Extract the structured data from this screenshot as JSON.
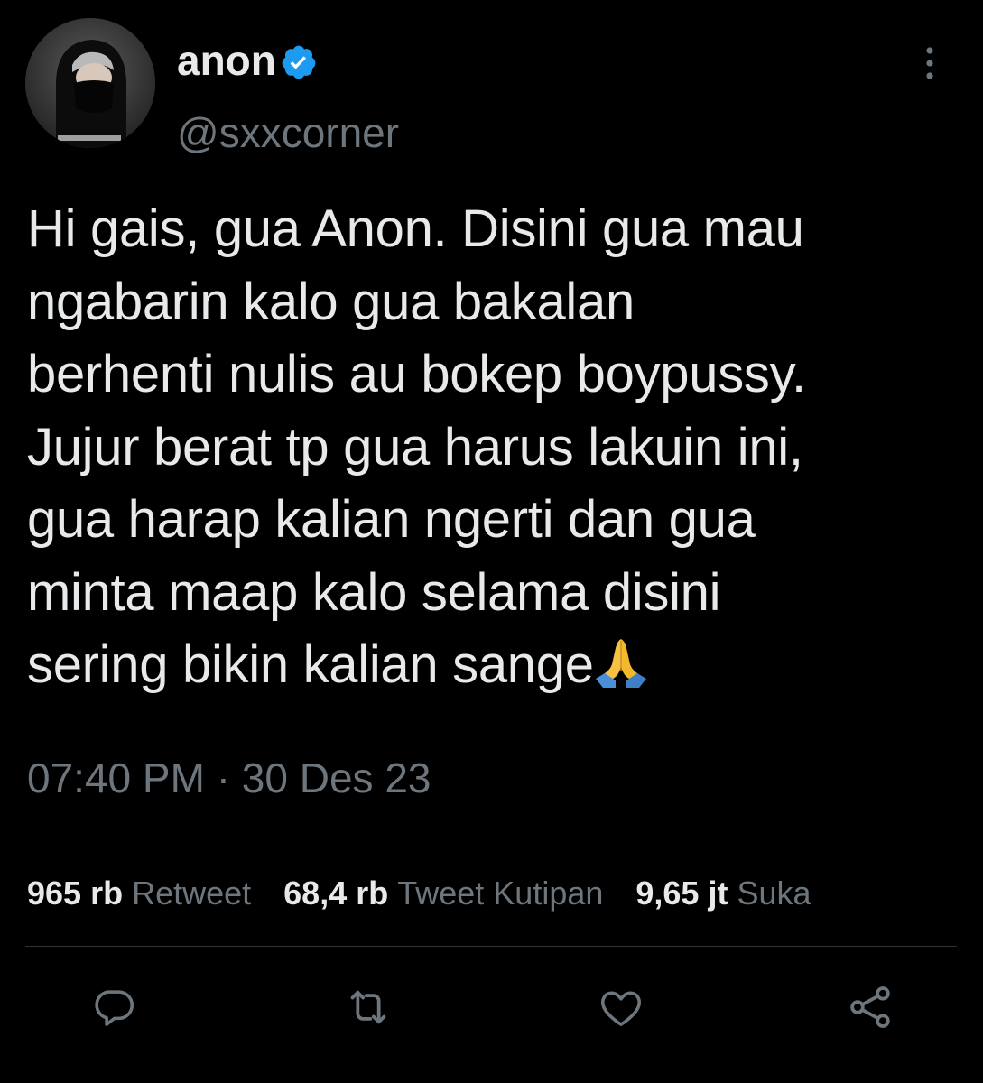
{
  "tweet": {
    "display_name": "anon",
    "handle": "@sxxcorner",
    "lines": [
      "Hi gais, gua Anon. Disini gua mau",
      "ngabarin kalo gua bakalan",
      "berhenti nulis au bokep boypussy.",
      "Jujur berat tp gua harus lakuin ini,",
      "gua harap kalian ngerti dan gua",
      "minta maap kalo selama disini",
      "sering bikin kalian sange"
    ],
    "emoji": "🙏",
    "time": "07:40 PM",
    "separator": "·",
    "date": "30 Des 23"
  },
  "stats": {
    "retweets_count": "965 rb",
    "retweets_label": "Retweet",
    "quotes_count": "68,4 rb",
    "quotes_label": "Tweet Kutipan",
    "likes_count": "9,65 jt",
    "likes_label": "Suka"
  },
  "icons": {
    "verified": "verified-badge-icon",
    "more": "more-vertical-icon",
    "reply": "reply-icon",
    "retweet": "retweet-icon",
    "like": "heart-icon",
    "share": "share-icon"
  },
  "colors": {
    "background": "#000000",
    "text": "#e7e9ea",
    "secondary": "#6e767d",
    "divider": "#2f3336",
    "verified": "#1d9bf0"
  }
}
